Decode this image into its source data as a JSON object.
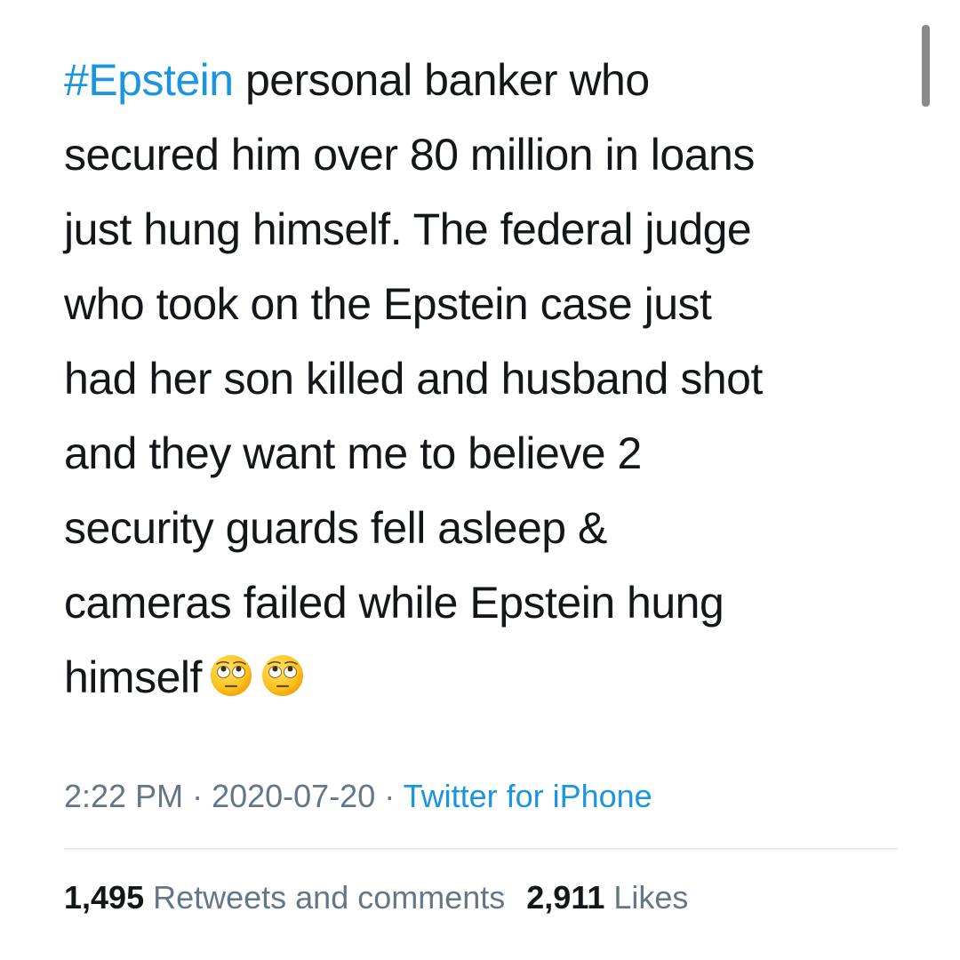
{
  "tweet": {
    "hashtag": "#Epstein",
    "lines": [
      " personal banker who",
      "secured him over 80 million in loans",
      "just hung himself. The federal judge",
      "who took on the Epstein case just",
      "had her son killed and husband shot",
      "and they want me to believe 2",
      "security guards fell asleep &",
      "cameras failed while Epstein hung",
      "himself"
    ],
    "emojis": [
      "face-with-rolling-eyes",
      "face-with-rolling-eyes"
    ]
  },
  "meta": {
    "time": "2:22 PM",
    "separator1": " · ",
    "date": "2020-07-20",
    "separator2": " · ",
    "source": "Twitter for iPhone"
  },
  "stats": {
    "retweets_count": "1,495",
    "retweets_label": " Retweets and comments",
    "likes_count": "2,911",
    "likes_label": " Likes"
  },
  "colors": {
    "text": "#14171a",
    "link": "#1b95e0",
    "secondary": "#657786",
    "divider": "#e6ecf0"
  }
}
